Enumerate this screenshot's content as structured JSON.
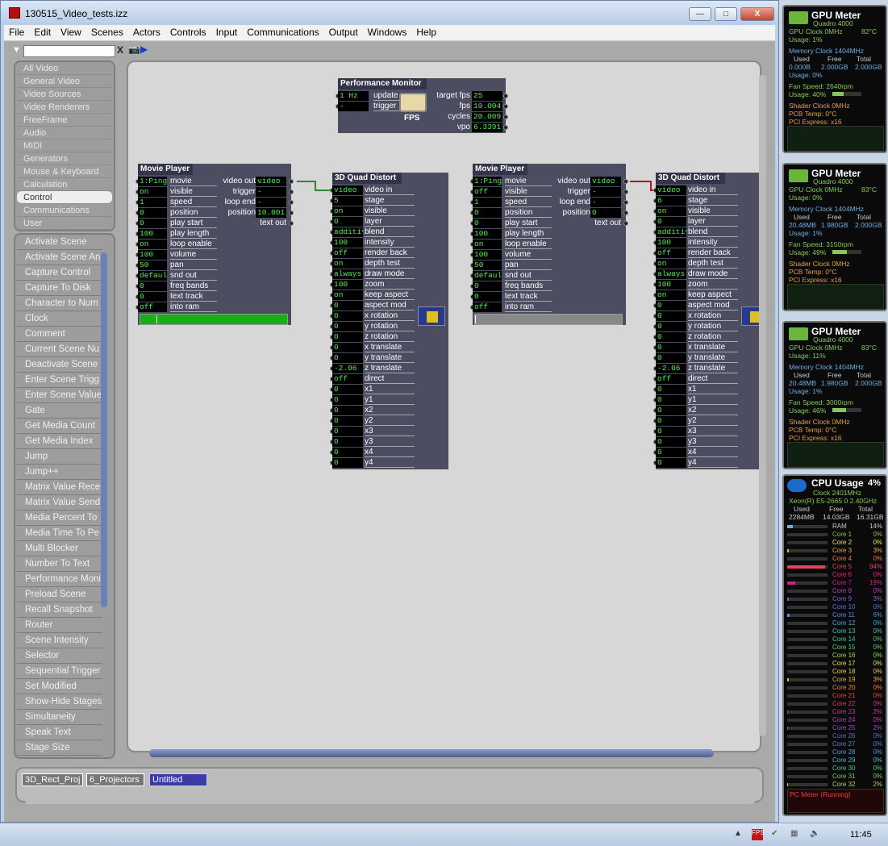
{
  "window": {
    "title": "130515_Video_tests.izz",
    "min": "—",
    "max": "□",
    "close": "X"
  },
  "menu": [
    "File",
    "Edit",
    "View",
    "Scenes",
    "Actors",
    "Controls",
    "Input",
    "Communications",
    "Output",
    "Windows",
    "Help"
  ],
  "toolbar": {
    "clear": "X"
  },
  "categories": [
    "All Video",
    "General Video",
    "Video Sources",
    "Video Renderers",
    "FreeFrame",
    "Audio",
    "MIDI",
    "Generators",
    "Mouse & Keyboard",
    "Calculation",
    "Control",
    "Communications",
    "User"
  ],
  "selected_category": "Control",
  "actors_list": [
    "Activate Scene",
    "Activate Scene An",
    "Capture Control",
    "Capture To Disk",
    "Character to Num",
    "Clock",
    "Comment",
    "Current Scene Nu",
    "Deactivate Scene",
    "Enter Scene Trigg",
    "Enter Scene Value",
    "Gate",
    "Get Media Count",
    "Get Media Index",
    "Jump",
    "Jump++",
    "Matrix Value Rece",
    "Matrix Value Send",
    "Media Percent To",
    "Media Time To Pe",
    "Multi Blocker",
    "Number To Text",
    "Performance Moni",
    "Preload Scene",
    "Recall Snapshot",
    "Router",
    "Scene Intensity",
    "Selector",
    "Sequential Trigger",
    "Set Modified",
    "Show-Hide Stages",
    "Simultaneity",
    "Speak Text",
    "Stage Size"
  ],
  "perf": {
    "title": "Performance Monitor",
    "inputs": [
      {
        "v": "1 Hz",
        "l": "update"
      },
      {
        "v": "-",
        "l": "trigger"
      }
    ],
    "outputs": [
      {
        "l": "target fps",
        "v": "25"
      },
      {
        "l": "fps",
        "v": "10.004"
      },
      {
        "l": "cycles",
        "v": "20.009"
      },
      {
        "l": "vpo",
        "v": "6.3391"
      }
    ],
    "icon_label": "FPS"
  },
  "movie_players": [
    {
      "title": "Movie Player",
      "inputs": [
        [
          "1:Ping_",
          "movie"
        ],
        [
          "on",
          "visible"
        ],
        [
          "1",
          "speed"
        ],
        [
          "0",
          "position"
        ],
        [
          "0",
          "play start"
        ],
        [
          "100",
          "play length"
        ],
        [
          "on",
          "loop enable"
        ],
        [
          "100",
          "volume"
        ],
        [
          "50",
          "pan"
        ],
        [
          "default",
          "snd out"
        ],
        [
          "0",
          "freq bands"
        ],
        [
          "0",
          "text track"
        ],
        [
          "off",
          "into ram"
        ]
      ],
      "outputs": [
        [
          "video out",
          "video"
        ],
        [
          "trigger",
          "-"
        ],
        [
          "loop end",
          "-"
        ],
        [
          "position",
          "10.001"
        ],
        [
          "text out",
          ""
        ]
      ],
      "progress": 0.11
    },
    {
      "title": "Movie Player",
      "inputs": [
        [
          "1:Ping_",
          "movie"
        ],
        [
          "off",
          "visible"
        ],
        [
          "1",
          "speed"
        ],
        [
          "0",
          "position"
        ],
        [
          "0",
          "play start"
        ],
        [
          "100",
          "play length"
        ],
        [
          "on",
          "loop enable"
        ],
        [
          "100",
          "volume"
        ],
        [
          "50",
          "pan"
        ],
        [
          "default",
          "snd out"
        ],
        [
          "0",
          "freq bands"
        ],
        [
          "0",
          "text track"
        ],
        [
          "off",
          "into ram"
        ]
      ],
      "outputs": [
        [
          "video out",
          "video"
        ],
        [
          "trigger",
          "-"
        ],
        [
          "loop end",
          "-"
        ],
        [
          "position",
          "0"
        ],
        [
          "text out",
          ""
        ]
      ],
      "progress": 0
    }
  ],
  "quad_distorts": [
    {
      "title": "3D Quad Distort",
      "inputs": [
        [
          "video",
          "video in"
        ],
        [
          "5",
          "stage"
        ],
        [
          "on",
          "visible"
        ],
        [
          "0",
          "layer"
        ],
        [
          "additive",
          "blend"
        ],
        [
          "100",
          "intensity"
        ],
        [
          "off",
          "render back"
        ],
        [
          "on",
          "depth test"
        ],
        [
          "always",
          "draw mode"
        ],
        [
          "100",
          "zoom"
        ],
        [
          "on",
          "keep aspect"
        ],
        [
          "0",
          "aspect mod"
        ],
        [
          "0",
          "x rotation"
        ],
        [
          "0",
          "y rotation"
        ],
        [
          "0",
          "z rotation"
        ],
        [
          "0",
          "x translate"
        ],
        [
          "0",
          "y translate"
        ],
        [
          "-2.06",
          "z translate"
        ],
        [
          "off",
          "direct"
        ],
        [
          "0",
          "x1"
        ],
        [
          "0",
          "y1"
        ],
        [
          "0",
          "x2"
        ],
        [
          "0",
          "y2"
        ],
        [
          "0",
          "x3"
        ],
        [
          "0",
          "y3"
        ],
        [
          "0",
          "x4"
        ],
        [
          "0",
          "y4"
        ]
      ]
    },
    {
      "title": "3D Quad Distort",
      "inputs": [
        [
          "video",
          "video in"
        ],
        [
          "6",
          "stage"
        ],
        [
          "on",
          "visible"
        ],
        [
          "0",
          "layer"
        ],
        [
          "additive",
          "blend"
        ],
        [
          "100",
          "intensity"
        ],
        [
          "off",
          "render back"
        ],
        [
          "on",
          "depth test"
        ],
        [
          "always",
          "draw mode"
        ],
        [
          "100",
          "zoom"
        ],
        [
          "on",
          "keep aspect"
        ],
        [
          "0",
          "aspect mod"
        ],
        [
          "0",
          "x rotation"
        ],
        [
          "0",
          "y rotation"
        ],
        [
          "0",
          "z rotation"
        ],
        [
          "0",
          "x translate"
        ],
        [
          "0",
          "y translate"
        ],
        [
          "-2.06",
          "z translate"
        ],
        [
          "off",
          "direct"
        ],
        [
          "0",
          "x1"
        ],
        [
          "0",
          "y1"
        ],
        [
          "0",
          "x2"
        ],
        [
          "0",
          "y2"
        ],
        [
          "0",
          "x3"
        ],
        [
          "0",
          "y3"
        ],
        [
          "0",
          "x4"
        ],
        [
          "0",
          "y4"
        ]
      ]
    }
  ],
  "scenes": [
    {
      "label": "3D_Rect_Proj",
      "active": false
    },
    {
      "label": "6_Projectors",
      "active": false
    },
    {
      "label": "Untitled",
      "active": true
    }
  ],
  "gpu_meters": [
    {
      "title": "GPU Meter",
      "card": "Quadro 4000",
      "clock": "GPU Clock 0MHz",
      "temp": "82°C",
      "usage": "Usage: 1%",
      "mem": "Memory Clock 1404MHz",
      "used": "0.000B",
      "free": "2.000GB",
      "total": "2.000GB",
      "musage": "Usage: 0%",
      "fan": "Fan Speed: 2640rpm",
      "fusage": "Usage: 40%",
      "fan_level": 0.4,
      "shader": "Shader Clock 0MHz",
      "pcb": "PCB Temp: 0°C",
      "pci": "PCI Express: x16"
    },
    {
      "title": "GPU Meter",
      "card": "Quadro 4000",
      "clock": "GPU Clock 0MHz",
      "temp": "83°C",
      "usage": "Usage: 0%",
      "mem": "Memory Clock 1404MHz",
      "used": "20.48MB",
      "free": "1.980GB",
      "total": "2.000GB",
      "musage": "Usage: 1%",
      "fan": "Fan Speed: 3150rpm",
      "fusage": "Usage: 49%",
      "fan_level": 0.49,
      "shader": "Shader Clock 0MHz",
      "pcb": "PCB Temp: 0°C",
      "pci": "PCI Express: x16"
    },
    {
      "title": "GPU Meter",
      "card": "Quadro 4000",
      "clock": "GPU Clock 0MHz",
      "temp": "83°C",
      "usage": "Usage: 11%",
      "mem": "Memory Clock 1404MHz",
      "used": "20.48MB",
      "free": "1.980GB",
      "total": "2.000GB",
      "musage": "Usage: 1%",
      "fan": "Fan Speed: 3000rpm",
      "fusage": "Usage: 46%",
      "fan_level": 0.46,
      "shader": "Shader Clock 0MHz",
      "pcb": "PCB Temp: 0°C",
      "pci": "PCI Express: x16"
    }
  ],
  "gpu_headers": {
    "used": "Used",
    "free": "Free",
    "total": "Total"
  },
  "cpu": {
    "title": "CPU Usage",
    "pct": "4%",
    "clock": "Clock 2401MHz",
    "model": "Xeon(R) E5-2665 0 2.40GHz",
    "used_label": "Used",
    "free_label": "Free",
    "total_label": "Total",
    "used": "2284MB",
    "free": "14.03GB",
    "total": "16.31GB",
    "ram": {
      "label": "RAM",
      "pct": "14%"
    },
    "cores": [
      {
        "n": "Core 1",
        "p": "0%",
        "c": "#7ec850"
      },
      {
        "n": "Core 2",
        "p": "0%",
        "c": "#e8e850"
      },
      {
        "n": "Core 3",
        "p": "3%",
        "c": "#e8b040"
      },
      {
        "n": "Core 4",
        "p": "0%",
        "c": "#e88040"
      },
      {
        "n": "Core 5",
        "p": "94%",
        "c": "#e84060"
      },
      {
        "n": "Core 6",
        "p": "0%",
        "c": "#e82080"
      },
      {
        "n": "Core 7",
        "p": "19%",
        "c": "#d02090"
      },
      {
        "n": "Core 8",
        "p": "0%",
        "c": "#b040c0"
      },
      {
        "n": "Core 9",
        "p": "3%",
        "c": "#8060d0"
      },
      {
        "n": "Core 10",
        "p": "0%",
        "c": "#6070d8"
      },
      {
        "n": "Core 11",
        "p": "6%",
        "c": "#5090e0"
      },
      {
        "n": "Core 12",
        "p": "0%",
        "c": "#40a8d8"
      },
      {
        "n": "Core 13",
        "p": "0%",
        "c": "#40c0c0"
      },
      {
        "n": "Core 14",
        "p": "0%",
        "c": "#40c890"
      },
      {
        "n": "Core 15",
        "p": "0%",
        "c": "#60d060"
      },
      {
        "n": "Core 16",
        "p": "0%",
        "c": "#a0d840"
      },
      {
        "n": "Core 17",
        "p": "0%",
        "c": "#e0e040"
      },
      {
        "n": "Core 18",
        "p": "0%",
        "c": "#f0d040"
      },
      {
        "n": "Core 19",
        "p": "3%",
        "c": "#f0b030"
      },
      {
        "n": "Core 20",
        "p": "0%",
        "c": "#f08030"
      },
      {
        "n": "Core 21",
        "p": "0%",
        "c": "#f04040"
      },
      {
        "n": "Core 22",
        "p": "0%",
        "c": "#e83070"
      },
      {
        "n": "Core 23",
        "p": "2%",
        "c": "#d83090"
      },
      {
        "n": "Core 24",
        "p": "0%",
        "c": "#b840b0"
      },
      {
        "n": "Core 25",
        "p": "2%",
        "c": "#9050c8"
      },
      {
        "n": "Core 26",
        "p": "0%",
        "c": "#7060d0"
      },
      {
        "n": "Core 27",
        "p": "0%",
        "c": "#5080d8"
      },
      {
        "n": "Core 28",
        "p": "0%",
        "c": "#40a0d8"
      },
      {
        "n": "Core 29",
        "p": "0%",
        "c": "#40c0c0"
      },
      {
        "n": "Core 30",
        "p": "0%",
        "c": "#40c890"
      },
      {
        "n": "Core 31",
        "p": "0%",
        "c": "#70d060"
      },
      {
        "n": "Core 32",
        "p": "2%",
        "c": "#b0d840"
      }
    ],
    "graph_label": "PC Meter (Running)"
  },
  "taskbar": {
    "clock": "11:45"
  }
}
